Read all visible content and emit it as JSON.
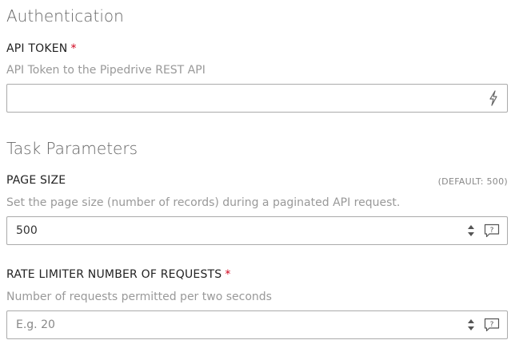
{
  "sections": {
    "authentication": {
      "title": "Authentication"
    },
    "task_parameters": {
      "title": "Task Parameters"
    }
  },
  "fields": {
    "api_token": {
      "label": "API TOKEN",
      "required_marker": "*",
      "description": "API Token to the Pipedrive REST API",
      "value": "",
      "placeholder": "",
      "icon": "lightning-icon"
    },
    "page_size": {
      "label": "PAGE SIZE",
      "default_hint": "(DEFAULT: 500)",
      "description": "Set the page size (number of records) during a paginated API request.",
      "value": "500",
      "icons": [
        "spinner-arrows-icon",
        "help-comment-icon"
      ]
    },
    "rate_limiter": {
      "label": "RATE LIMITER NUMBER OF REQUESTS",
      "required_marker": "*",
      "description": "Number of requests permitted per two seconds",
      "value": "",
      "placeholder": "E.g. 20",
      "icons": [
        "spinner-arrows-icon",
        "help-comment-icon"
      ]
    }
  },
  "colors": {
    "required": "#d0021b",
    "border": "#aaaaaa",
    "description": "#999999"
  }
}
